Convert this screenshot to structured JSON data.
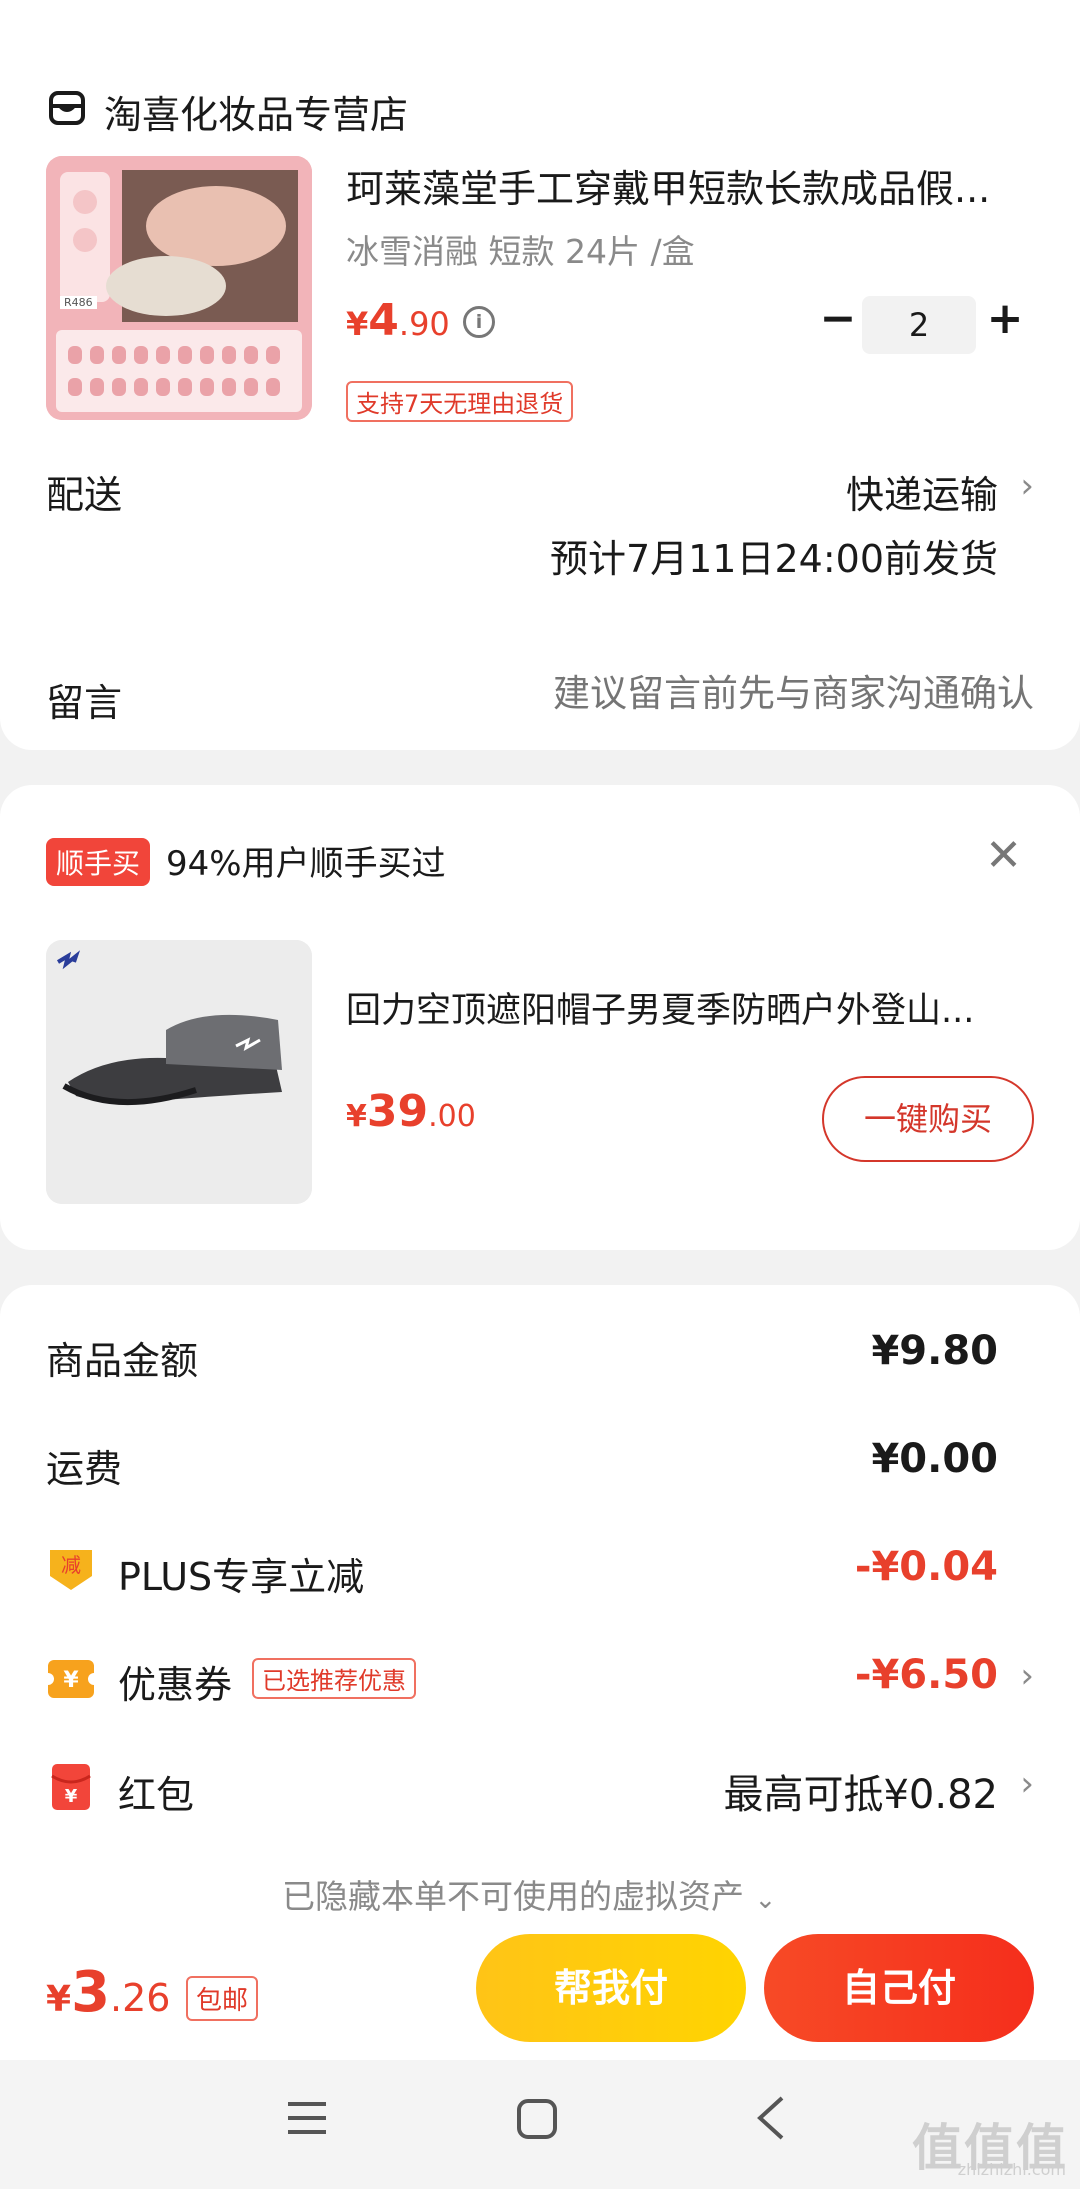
{
  "shop": {
    "name": "淘喜化妆品专营店",
    "product": {
      "title": "珂莱藻堂手工穿戴甲短款长款成品假...",
      "spec": "冰雪消融 短款 24片 /盒",
      "price_symbol": "¥",
      "price_int": "4",
      "price_dec": ".90",
      "return_policy": "支持7天无理由退货",
      "quantity": "2",
      "image_label": "R486"
    },
    "delivery_label": "配送",
    "delivery_method": "快递运输",
    "delivery_eta": "预计7月11日24:00前发货",
    "note_label": "留言",
    "note_placeholder": "建议留言前先与商家沟通确认"
  },
  "recommend": {
    "tag": "顺手买",
    "text": "94%用户顺手买过",
    "product_title": "回力空顶遮阳帽子男夏季防晒户外登山...",
    "price_symbol": "¥",
    "price_int": "39",
    "price_dec": ".00",
    "buy_label": "一键购买"
  },
  "summary": {
    "goods_label": "商品金额",
    "goods_value": "¥9.80",
    "shipping_label": "运费",
    "shipping_value": "¥0.00",
    "plus_label": "PLUS专享立减",
    "plus_icon_text": "减",
    "plus_value": "-¥0.04",
    "coupon_label": "优惠券",
    "coupon_tag": "已选推荐优惠",
    "coupon_icon_text": "¥",
    "coupon_value": "-¥6.50",
    "redpacket_label": "红包",
    "redpacket_icon_text": "¥",
    "redpacket_value": "最高可抵¥0.82",
    "hidden_assets": "已隐藏本单不可使用的虚拟资产"
  },
  "bottom": {
    "total_symbol": "¥",
    "total_int": "3",
    "total_dec": ".26",
    "free_shipping": "包邮",
    "help_pay": "帮我付",
    "self_pay": "自己付"
  },
  "watermark": {
    "text": "值值值",
    "url": "zhizhizhi.com"
  },
  "colors": {
    "accent_red": "#e8402c",
    "help_yellow": "#ffc417",
    "self_red": "#f52e1c"
  }
}
